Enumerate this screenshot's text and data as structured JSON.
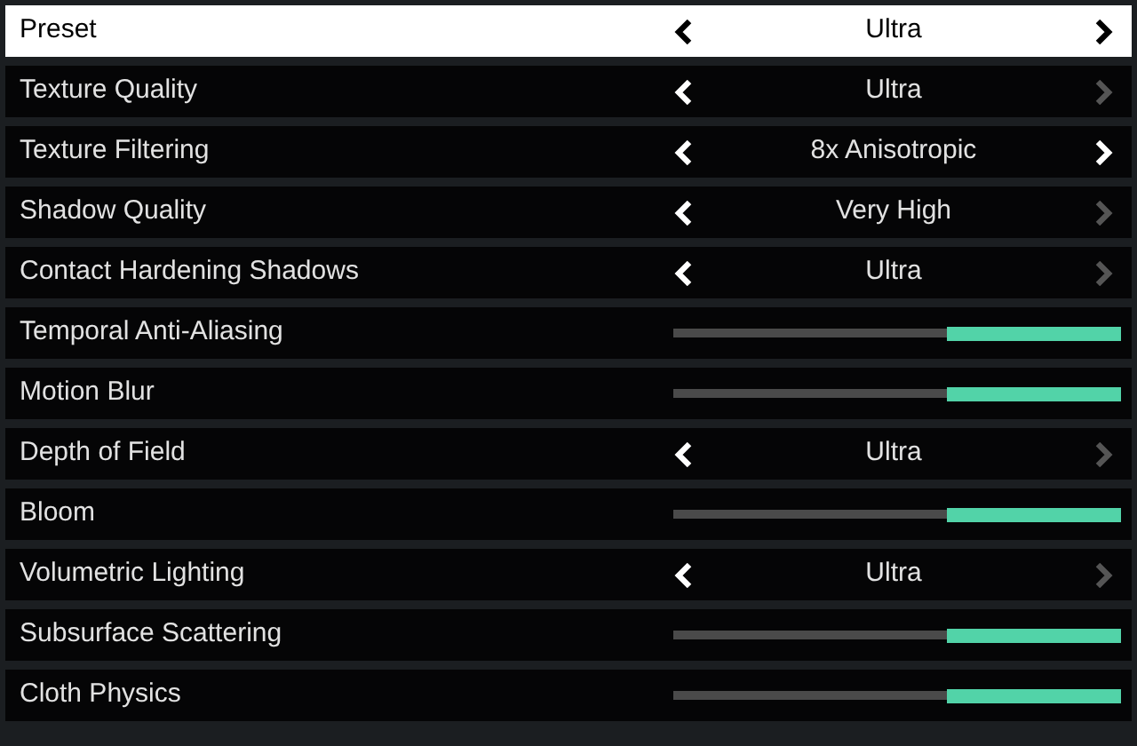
{
  "settings": [
    {
      "kind": "option",
      "label": "Preset",
      "value": "Ultra",
      "selected": true,
      "prev_enabled": true,
      "next_enabled": true
    },
    {
      "kind": "option",
      "label": "Texture Quality",
      "value": "Ultra",
      "selected": false,
      "prev_enabled": true,
      "next_enabled": false
    },
    {
      "kind": "option",
      "label": "Texture Filtering",
      "value": "8x Anisotropic",
      "selected": false,
      "prev_enabled": true,
      "next_enabled": true
    },
    {
      "kind": "option",
      "label": "Shadow Quality",
      "value": "Very High",
      "selected": false,
      "prev_enabled": true,
      "next_enabled": false
    },
    {
      "kind": "option",
      "label": "Contact Hardening Shadows",
      "value": "Ultra",
      "selected": false,
      "prev_enabled": true,
      "next_enabled": false
    },
    {
      "kind": "slider",
      "label": "Temporal Anti-Aliasing",
      "selected": false,
      "level": 0.39
    },
    {
      "kind": "slider",
      "label": "Motion Blur",
      "selected": false,
      "level": 0.39
    },
    {
      "kind": "option",
      "label": "Depth of Field",
      "value": "Ultra",
      "selected": false,
      "prev_enabled": true,
      "next_enabled": false
    },
    {
      "kind": "slider",
      "label": "Bloom",
      "selected": false,
      "level": 0.39
    },
    {
      "kind": "option",
      "label": "Volumetric Lighting",
      "value": "Ultra",
      "selected": false,
      "prev_enabled": true,
      "next_enabled": false
    },
    {
      "kind": "slider",
      "label": "Subsurface Scattering",
      "selected": false,
      "level": 0.39
    },
    {
      "kind": "slider",
      "label": "Cloth Physics",
      "selected": false,
      "level": 0.39
    }
  ]
}
